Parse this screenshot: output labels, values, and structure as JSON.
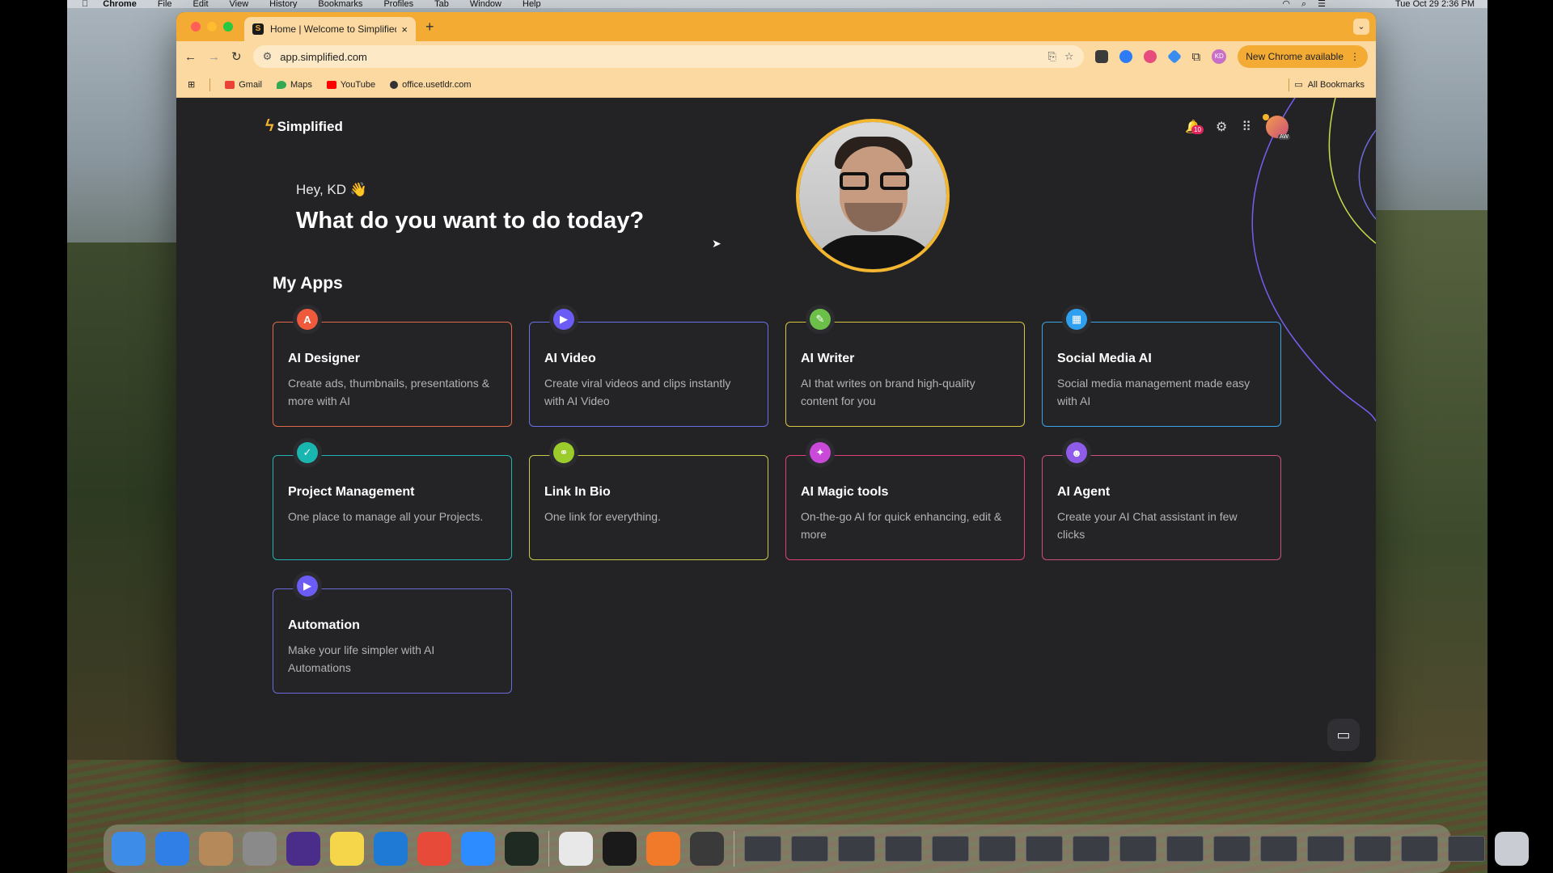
{
  "menubar": {
    "apple": "",
    "items": [
      "Chrome",
      "File",
      "Edit",
      "View",
      "History",
      "Bookmarks",
      "Profiles",
      "Tab",
      "Window",
      "Help"
    ],
    "clock": "Tue Oct 29  2:36 PM"
  },
  "browser": {
    "tab_title": "Home | Welcome to Simplified",
    "tab_close": "×",
    "new_tab": "+",
    "tab_menu": "⌄",
    "url": "app.simplified.com",
    "update_label": "New Chrome available",
    "profile_initials": "KD",
    "bookmarks": [
      {
        "label": "Gmail",
        "color": "#ea4335"
      },
      {
        "label": "Maps",
        "color": "#34a853"
      },
      {
        "label": "YouTube",
        "color": "#ff0000"
      },
      {
        "label": "office.usetldr.com",
        "color": "#333333"
      }
    ],
    "all_bookmarks": "All Bookmarks"
  },
  "page": {
    "brand": "Simplified",
    "notification_count": "10",
    "avatar_initials": "AW",
    "greeting": "Hey, KD 👋",
    "headline": "What do you want to do today?",
    "section_title": "My Apps",
    "apps": [
      {
        "title": "AI Designer",
        "desc": "Create ads, thumbnails, presentations & more with AI",
        "color": "#ef5a3c",
        "border": "#e0694a",
        "glyph": "A",
        "icon": "designer-icon"
      },
      {
        "title": "AI Video",
        "desc": "Create viral videos and clips instantly with AI Video",
        "color": "#6b5cf5",
        "border": "#6a70e8",
        "glyph": "▶",
        "icon": "video-icon"
      },
      {
        "title": "AI Writer",
        "desc": "AI that writes on brand high-quality content for you",
        "color": "#6cc04a",
        "border": "#d8c640",
        "glyph": "✎",
        "icon": "writer-icon"
      },
      {
        "title": "Social Media AI",
        "desc": "Social media management made easy with AI",
        "color": "#2f9ff0",
        "border": "#3aa4e6",
        "glyph": "▦",
        "icon": "calendar-icon"
      },
      {
        "title": "Project Management",
        "desc": "One place to manage all your Projects.",
        "color": "#19b6b0",
        "border": "#22b3b0",
        "glyph": "✓",
        "icon": "checklist-icon"
      },
      {
        "title": "Link In Bio",
        "desc": "One link for everything.",
        "color": "#9ccb2c",
        "border": "#c8c94a",
        "glyph": "⚭",
        "icon": "link-icon"
      },
      {
        "title": "AI Magic tools",
        "desc": "On-the-go AI for quick enhancing, edit & more",
        "color": "#c94ad8",
        "border": "#e0407a",
        "glyph": "✦",
        "icon": "sparkle-icon"
      },
      {
        "title": "AI Agent",
        "desc": "Create your AI Chat assistant in few clicks",
        "color": "#8e5ce8",
        "border": "#c8507a",
        "glyph": "☻",
        "icon": "robot-icon"
      },
      {
        "title": "Automation",
        "desc": "Make your life simpler with AI Automations",
        "color": "#6b5cf5",
        "border": "#6a6ad8",
        "glyph": "▶",
        "icon": "play-icon"
      }
    ]
  },
  "dock": {
    "apps": [
      {
        "name": "finder",
        "color": "#3c8ce8"
      },
      {
        "name": "safari",
        "color": "#2f7fe6"
      },
      {
        "name": "contacts",
        "color": "#b5895a"
      },
      {
        "name": "launchpad",
        "color": "#8a8a8a"
      },
      {
        "name": "arc",
        "color": "#4a2c8a"
      },
      {
        "name": "notes",
        "color": "#f5d64a"
      },
      {
        "name": "vscode",
        "color": "#1f7ad6"
      },
      {
        "name": "chrome",
        "color": "#e84a3a"
      },
      {
        "name": "zoom",
        "color": "#2d8cff"
      },
      {
        "name": "activity-monitor",
        "color": "#1e2a22"
      }
    ],
    "apps2": [
      {
        "name": "slack",
        "color": "#e8e8e8"
      },
      {
        "name": "terminal",
        "color": "#1a1a1a"
      },
      {
        "name": "pages",
        "color": "#f07a2a"
      },
      {
        "name": "sublime",
        "color": "#3a3a3a"
      }
    ],
    "thumb_count": 16,
    "trash": "trash"
  }
}
